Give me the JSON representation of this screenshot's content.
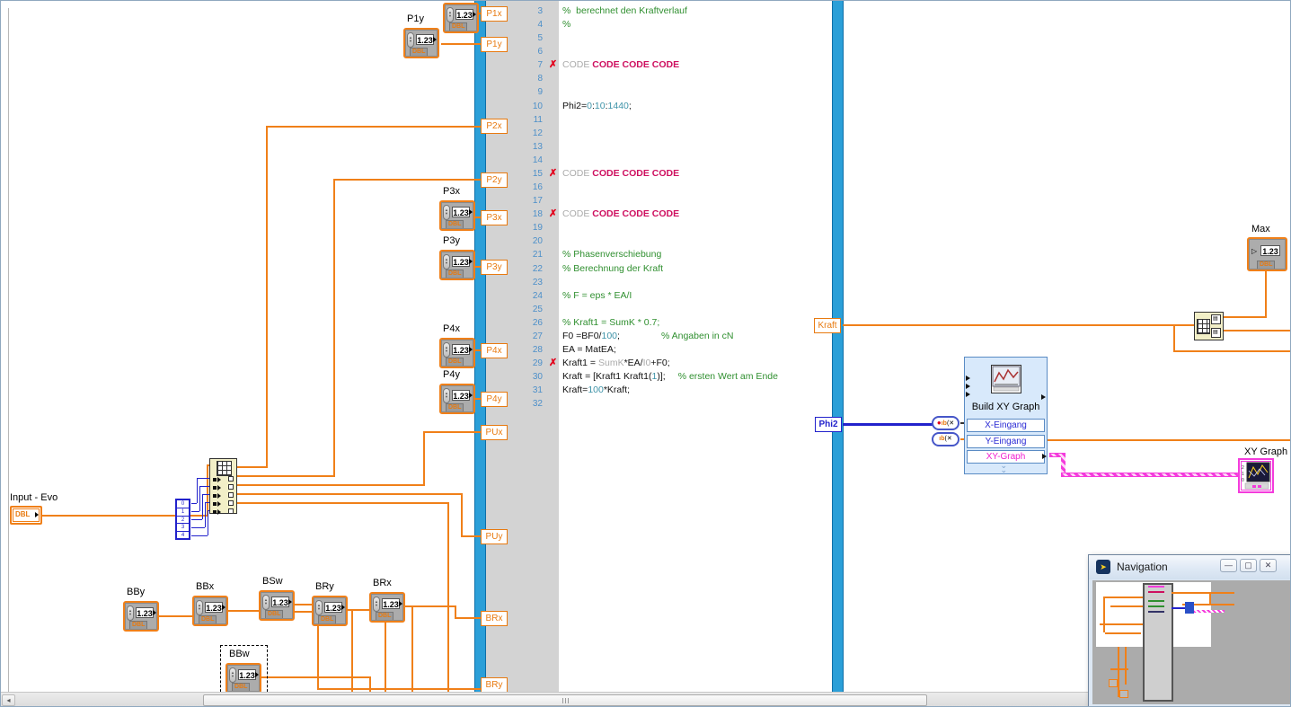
{
  "colors": {
    "wire_dbl": "#F08019",
    "wire_i32": "#2222CC",
    "wire_dynamic": "#F43BDC",
    "script_border": "#2B9FD8",
    "comment_green": "#2F8F2F",
    "error_text": "#CE0F5F",
    "express_bg": "#D8E9FB"
  },
  "script_node": {
    "left_terminals": [
      "P1x",
      "P1y",
      "P2x",
      "P2y",
      "P3x",
      "P3y",
      "P4x",
      "P4y",
      "PUx",
      "PUy",
      "BRx",
      "BRy"
    ],
    "right_terminals": [
      "Kraft",
      "Phi2"
    ],
    "error_mark": "✗",
    "code_lines": [
      {
        "n": "3",
        "segs": [
          {
            "t": "%  berechnet den Kraftverlauf",
            "c": "cm"
          }
        ]
      },
      {
        "n": "4",
        "segs": [
          {
            "t": "%",
            "c": "cm"
          }
        ]
      },
      {
        "n": "5",
        "segs": []
      },
      {
        "n": "6",
        "segs": []
      },
      {
        "n": "7",
        "x": true,
        "segs": [
          {
            "t": "CODE ",
            "c": "dim"
          },
          {
            "t": "CODE CODE CODE",
            "c": "err"
          }
        ]
      },
      {
        "n": "8",
        "segs": []
      },
      {
        "n": "9",
        "segs": []
      },
      {
        "n": "10",
        "segs": [
          {
            "t": "Phi2=",
            "c": "k"
          },
          {
            "t": "0",
            "c": "num"
          },
          {
            "t": ":",
            "c": "k"
          },
          {
            "t": "10",
            "c": "num"
          },
          {
            "t": ":",
            "c": "k"
          },
          {
            "t": "1440",
            "c": "num"
          },
          {
            "t": ";",
            "c": "k"
          }
        ]
      },
      {
        "n": "11",
        "segs": []
      },
      {
        "n": "12",
        "segs": []
      },
      {
        "n": "13",
        "segs": []
      },
      {
        "n": "14",
        "segs": []
      },
      {
        "n": "15",
        "x": true,
        "segs": [
          {
            "t": "CODE ",
            "c": "dim"
          },
          {
            "t": "CODE CODE CODE",
            "c": "err"
          }
        ]
      },
      {
        "n": "16",
        "segs": []
      },
      {
        "n": "17",
        "segs": []
      },
      {
        "n": "18",
        "x": true,
        "segs": [
          {
            "t": "CODE ",
            "c": "dim"
          },
          {
            "t": "CODE CODE CODE",
            "c": "err"
          }
        ]
      },
      {
        "n": "19",
        "segs": []
      },
      {
        "n": "20",
        "segs": []
      },
      {
        "n": "21",
        "segs": [
          {
            "t": "% Phasenverschiebung",
            "c": "cm"
          }
        ]
      },
      {
        "n": "22",
        "segs": [
          {
            "t": "% Berechnung der Kraft",
            "c": "cm"
          }
        ]
      },
      {
        "n": "23",
        "segs": []
      },
      {
        "n": "24",
        "segs": [
          {
            "t": "% F = eps * EA/I",
            "c": "cm"
          }
        ]
      },
      {
        "n": "25",
        "segs": []
      },
      {
        "n": "26",
        "segs": [
          {
            "t": "% Kraft1 = SumK * 0.7;",
            "c": "cm"
          }
        ]
      },
      {
        "n": "27",
        "segs": [
          {
            "t": "F0 =BF0/",
            "c": "k"
          },
          {
            "t": "100",
            "c": "num"
          },
          {
            "t": ";",
            "c": "k"
          },
          {
            "t": "% Angaben in cN",
            "c": "cm"
          }
        ]
      },
      {
        "n": "28",
        "segs": [
          {
            "t": "EA = MatEA;",
            "c": "k"
          }
        ]
      },
      {
        "n": "29",
        "x": true,
        "segs": [
          {
            "t": "Kraft1 = ",
            "c": "k"
          },
          {
            "t": "SumK",
            "c": "dim"
          },
          {
            "t": "*EA/",
            "c": "k"
          },
          {
            "t": "I0",
            "c": "dim"
          },
          {
            "t": "+F0;",
            "c": "k"
          }
        ]
      },
      {
        "n": "30",
        "segs": [
          {
            "t": "Kraft = [Kraft1 Kraft1(",
            "c": "k"
          },
          {
            "t": "1",
            "c": "num"
          },
          {
            "t": ")];",
            "c": "k"
          },
          {
            "t": "% ersten Wert am Ende",
            "c": "cm"
          }
        ]
      },
      {
        "n": "31",
        "segs": [
          {
            "t": "Kraft=",
            "c": "k"
          },
          {
            "t": "100",
            "c": "num"
          },
          {
            "t": "*Kraft;",
            "c": "k"
          }
        ]
      },
      {
        "n": "32",
        "segs": []
      }
    ]
  },
  "controls": {
    "value": "1.23",
    "type_label": "DBL",
    "items": [
      {
        "label": ""
      },
      {
        "label": "P1y"
      },
      {
        "label": "P3x"
      },
      {
        "label": "P3y"
      },
      {
        "label": "P4x"
      },
      {
        "label": "P4y"
      },
      {
        "label": "BBy"
      },
      {
        "label": "BBx"
      },
      {
        "label": "BSw"
      },
      {
        "label": "BRy"
      },
      {
        "label": "BRx"
      },
      {
        "label": "BBw"
      }
    ]
  },
  "array_control": {
    "label": "Input - Evo",
    "type_label": "DBL"
  },
  "index_constants": [
    "0",
    "1",
    "2",
    "3",
    "4"
  ],
  "express_vi": {
    "title": "Build XY Graph",
    "rows": [
      "X-Eingang",
      "Y-Eingang",
      "XY-Graph"
    ]
  },
  "indicators": {
    "max": {
      "label": "Max",
      "value": "1.23",
      "type_label": "DBL"
    },
    "xy_graph": {
      "label": "XY Graph"
    }
  },
  "navigation": {
    "title": "Navigation",
    "buttons": [
      {
        "name": "minimize",
        "glyph": "—"
      },
      {
        "name": "maximize",
        "glyph": "▢"
      },
      {
        "name": "close",
        "glyph": "✕"
      }
    ]
  }
}
